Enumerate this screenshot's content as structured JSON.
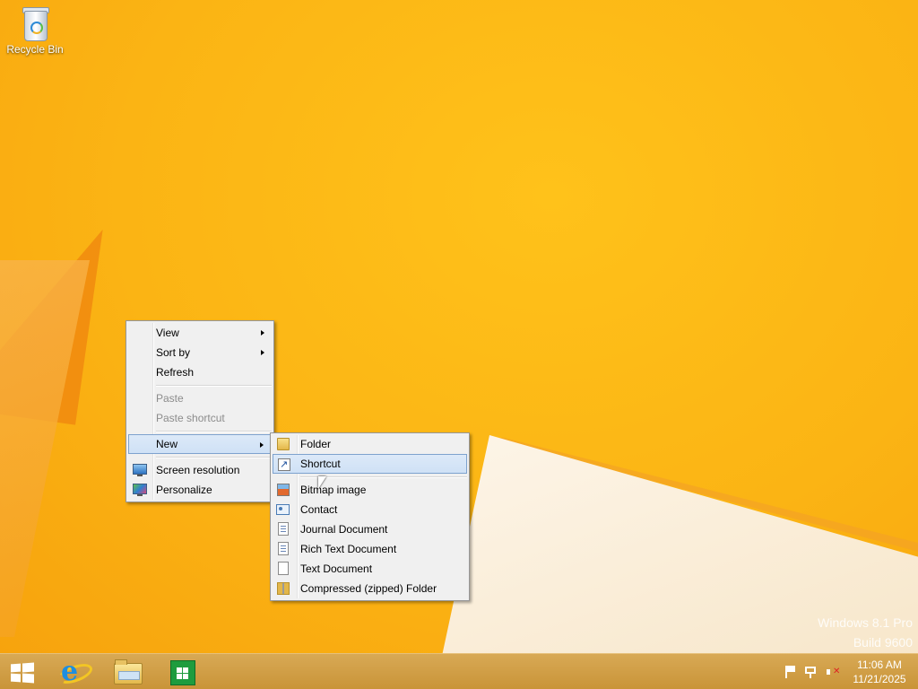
{
  "desktop": {
    "icons": [
      {
        "label": "Recycle Bin",
        "icon": "recycle-bin-icon"
      }
    ],
    "watermark": {
      "line1": "Windows 8.1 Pro",
      "line2": "Build 9600"
    },
    "accent_color": "#fbb414"
  },
  "context_menu": {
    "items": {
      "view": "View",
      "sort_by": "Sort by",
      "refresh": "Refresh",
      "paste": "Paste",
      "paste_shortcut": "Paste shortcut",
      "new": "New",
      "screen_resolution": "Screen resolution",
      "personalize": "Personalize"
    }
  },
  "new_submenu": {
    "items": {
      "folder": "Folder",
      "shortcut": "Shortcut",
      "bitmap": "Bitmap image",
      "contact": "Contact",
      "journal": "Journal Document",
      "rtf": "Rich Text Document",
      "text": "Text Document",
      "zip": "Compressed (zipped) Folder"
    },
    "highlighted": "Shortcut"
  },
  "taskbar": {
    "pinned": [
      "start-button",
      "internet-explorer",
      "file-explorer",
      "windows-store"
    ],
    "clock": {
      "time": "11:06 AM",
      "date": "11/21/2025"
    }
  }
}
